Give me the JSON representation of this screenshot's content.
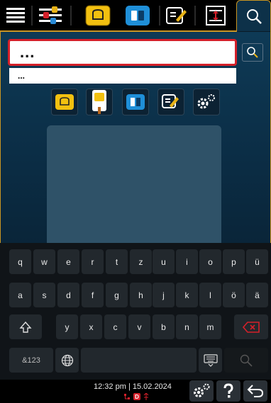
{
  "search": {
    "value": "...",
    "suggestion": "..."
  },
  "keyboard": {
    "row1": [
      "q",
      "w",
      "e",
      "r",
      "t",
      "z",
      "u",
      "i",
      "o",
      "p",
      "ü"
    ],
    "row2": [
      "a",
      "s",
      "d",
      "f",
      "g",
      "h",
      "j",
      "k",
      "l",
      "ö",
      "ä"
    ],
    "row3": [
      "y",
      "x",
      "c",
      "v",
      "b",
      "n",
      "m"
    ],
    "numbers_key": "&123"
  },
  "status": {
    "time": "12:32 pm",
    "separator": "|",
    "date": "15.02.2024"
  },
  "colors": {
    "gold_accent": "#c99522",
    "search_border": "#d4202a",
    "panel": "#0e3a56",
    "delete_red": "#d4202a"
  },
  "icons": {
    "top": [
      "menu-icon",
      "settings-sliders-icon",
      "cooking-icon",
      "program-icon",
      "edit-icon",
      "expand-icon",
      "search-icon"
    ],
    "filters": [
      "cooking-icon",
      "phone-cooking-icon",
      "program-icon",
      "edit-icon",
      "gears-icon"
    ]
  }
}
